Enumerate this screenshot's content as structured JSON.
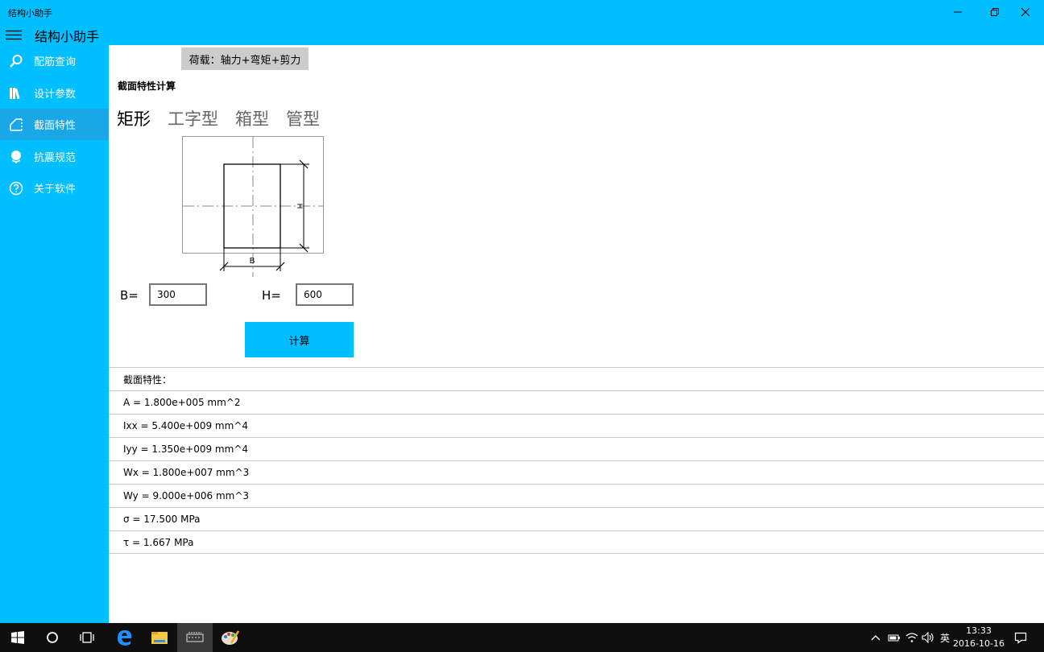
{
  "window": {
    "title": "结构小助手",
    "controls": {
      "minimize_icon": "minimize-icon",
      "restore_icon": "restore-icon",
      "close_icon": "close-icon"
    }
  },
  "header": {
    "app_name": "结构小助手",
    "menu_icon": "hamburger-icon"
  },
  "sidebar": {
    "items": [
      {
        "label": "配筋查询",
        "icon": "search-icon",
        "active": false
      },
      {
        "label": "设计参数",
        "icon": "books-icon",
        "active": false
      },
      {
        "label": "截面特性",
        "icon": "section-icon",
        "active": true
      },
      {
        "label": "抗震规范",
        "icon": "globe-icon",
        "active": false
      },
      {
        "label": "关于软件",
        "icon": "help-icon",
        "active": false
      }
    ]
  },
  "main": {
    "load_tag": "荷载：轴力+弯矩+剪力",
    "section_title": "截面特性计算",
    "tabs": [
      "矩形",
      "工字型",
      "箱型",
      "管型"
    ],
    "active_tab": "矩形",
    "diagram": {
      "width_label": "B",
      "height_label": "H"
    },
    "inputs": {
      "b_label": "B=",
      "b_value": "300",
      "h_label": "H=",
      "h_value": "600"
    },
    "calc_button": "计算",
    "results_header": "截面特性：",
    "results": [
      "A   = 1.800e+005  mm^2",
      "Ixx = 5.400e+009  mm^4",
      "Iyy = 1.350e+009  mm^4",
      "Wx = 1.800e+007  mm^3",
      "Wy = 9.000e+006  mm^3",
      "σ   = 17.500  MPa",
      "τ   = 1.667  MPa"
    ]
  },
  "taskbar": {
    "buttons": [
      "windows-start-icon",
      "cortana-icon",
      "task-view-icon",
      "edge-icon",
      "file-explorer-icon",
      "structure-app-icon",
      "paint-icon"
    ],
    "active_button": "structure-app-icon",
    "tray": {
      "chevron_icon": "chevron-up-icon",
      "battery_icon": "battery-icon",
      "wifi_icon": "wifi-icon",
      "volume_icon": "volume-icon",
      "ime": "英",
      "notification_icon": "notification-icon"
    },
    "time": "13:33",
    "date": "2016-10-16"
  },
  "colors": {
    "accent": "#00BFFF",
    "sidebar_active": "#1AA7E8",
    "load_tag_bg": "#CCCCCC",
    "taskbar_bg": "#0F0F0F"
  }
}
